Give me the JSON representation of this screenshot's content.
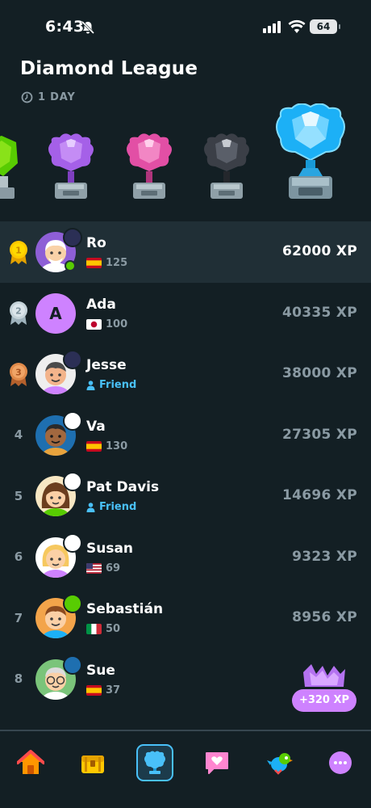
{
  "status_bar": {
    "time": "6:43",
    "battery": "64"
  },
  "league": {
    "title": "Diamond League",
    "time_left": "1 DAY"
  },
  "leaderboard": [
    {
      "rank": "1",
      "name": "Ro",
      "sub": "125",
      "flag": "es",
      "xp": "62000 XP"
    },
    {
      "rank": "2",
      "name": "Ada",
      "avatar_letter": "A",
      "sub": "100",
      "flag": "jp",
      "xp": "40335 XP"
    },
    {
      "rank": "3",
      "name": "Jesse",
      "sub": "Friend",
      "xp": "38000 XP"
    },
    {
      "rank": "4",
      "name": "Va",
      "sub": "130",
      "flag": "es",
      "xp": "27305 XP"
    },
    {
      "rank": "5",
      "name": "Pat Davis",
      "sub": "Friend",
      "xp": "14696 XP"
    },
    {
      "rank": "6",
      "name": "Susan",
      "sub": "69",
      "flag": "us",
      "xp": "9323 XP"
    },
    {
      "rank": "7",
      "name": "Sebastián",
      "sub": "50",
      "flag": "it",
      "xp": "8956 XP"
    },
    {
      "rank": "8",
      "name": "Sue",
      "sub": "37",
      "flag": "es",
      "xp": ""
    }
  ],
  "xp_gain": "+320 XP",
  "colors": {
    "background": "#131f24",
    "highlight_row": "#202f36",
    "accent_blue": "#49c0f8",
    "purple": "#ce82ff",
    "muted_text": "#8a9aa3"
  },
  "nav": [
    "home-icon",
    "chest-icon",
    "leaderboard-trophy-icon",
    "heart-chat-icon",
    "duo-bird-icon",
    "more-icon"
  ]
}
